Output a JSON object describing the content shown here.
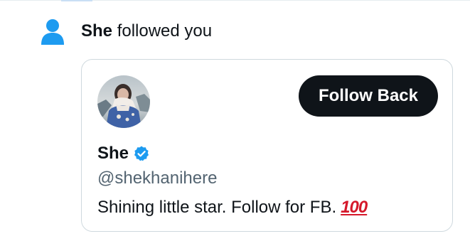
{
  "notification": {
    "type_icon": "person-icon",
    "actor_name": "She",
    "action_text": "followed you"
  },
  "card": {
    "avatar_icon": "profile-photo",
    "follow_back_label": "Follow Back",
    "display_name": "She",
    "verified_icon": "verified-badge-icon",
    "handle": "@shekhanihere",
    "bio_text": "Shining little star. Follow for FB.",
    "bio_emoji": "100"
  },
  "colors": {
    "accent_blue": "#1d9bf0",
    "button_bg": "#0f1419",
    "handle_gray": "#536471",
    "card_border": "#cfd9de",
    "emoji_red": "#d5192b"
  }
}
